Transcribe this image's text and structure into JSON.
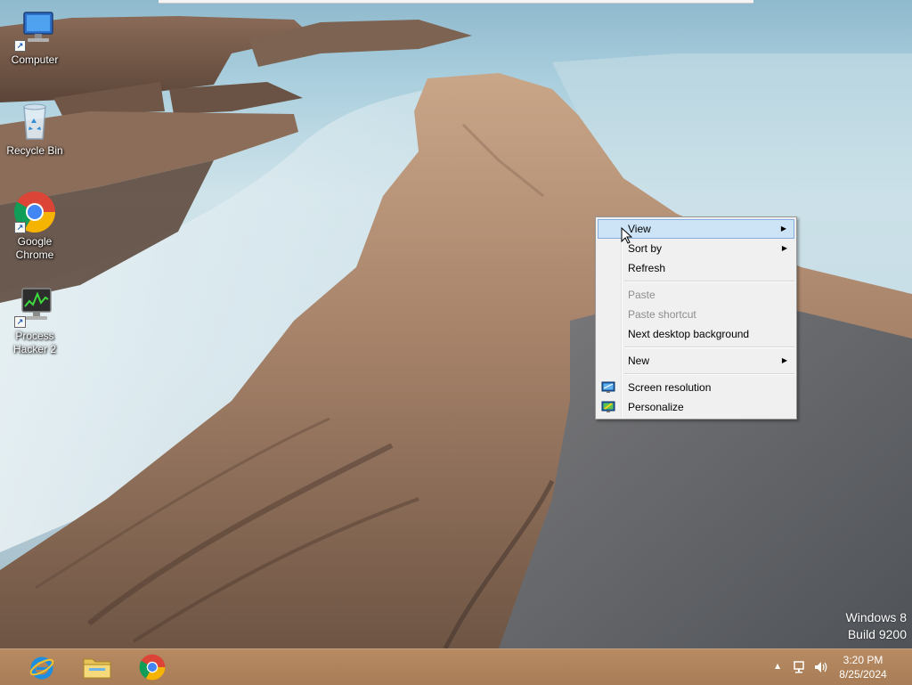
{
  "desktop": {
    "icons": [
      {
        "label": "Computer",
        "icon": "computer-icon"
      },
      {
        "label": "Recycle Bin",
        "icon": "recycle-bin-icon"
      },
      {
        "label": "Google Chrome",
        "icon": "chrome-icon"
      },
      {
        "label": "Process Hacker 2",
        "icon": "process-hacker-icon"
      }
    ],
    "watermark": {
      "line1": "Windows 8",
      "line2": "Build 9200"
    }
  },
  "context_menu": {
    "items": [
      {
        "label": "View",
        "submenu": true,
        "state": "highlighted"
      },
      {
        "label": "Sort by",
        "submenu": true
      },
      {
        "label": "Refresh"
      },
      {
        "label": "Paste",
        "state": "disabled"
      },
      {
        "label": "Paste shortcut",
        "state": "disabled"
      },
      {
        "label": "Next desktop background"
      },
      {
        "label": "New",
        "submenu": true
      },
      {
        "label": "Screen resolution",
        "icon": "monitor-icon"
      },
      {
        "label": "Personalize",
        "icon": "personalize-icon"
      }
    ],
    "submenu_arrow": "▶"
  },
  "taskbar": {
    "pinned": [
      {
        "name": "Internet Explorer",
        "icon": "internet-explorer-icon"
      },
      {
        "name": "File Explorer",
        "icon": "file-explorer-icon"
      },
      {
        "name": "Google Chrome",
        "icon": "chrome-icon"
      }
    ],
    "tray": {
      "show_hidden": "▲",
      "time": "3:20 PM",
      "date": "8/25/2024"
    }
  },
  "colors": {
    "taskbar": "#ab7f59",
    "menu_bg": "#f0f0f0",
    "menu_highlight": "#cde4f7",
    "menu_highlight_border": "#84acdd"
  }
}
